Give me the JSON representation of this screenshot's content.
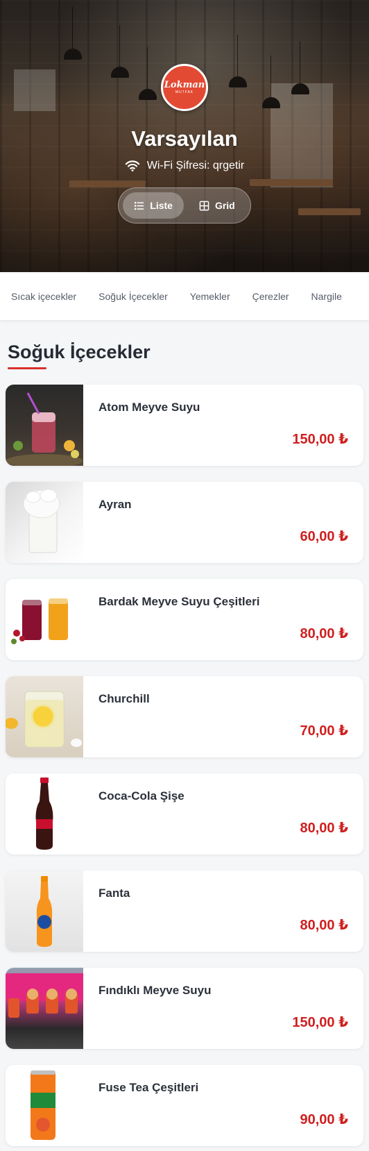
{
  "venue": {
    "logo_text": "Lokman",
    "logo_subtext": "MUTFAK",
    "title": "Varsayılan",
    "wifi_text": "Wi-Fi Şifresi: qrgetir"
  },
  "view_toggle": {
    "list_label": "Liste",
    "grid_label": "Grid",
    "active": "list"
  },
  "categories": [
    "Sıcak içecekler",
    "Soğuk İçecekler",
    "Yemekler",
    "Çerezler",
    "Nargile"
  ],
  "section": {
    "title": "Soğuk İçecekler"
  },
  "products": [
    {
      "name": "Atom Meyve Suyu",
      "price": "150,00 ₺"
    },
    {
      "name": "Ayran",
      "price": "60,00 ₺"
    },
    {
      "name": "Bardak Meyve Suyu Çeşitleri",
      "price": "80,00 ₺"
    },
    {
      "name": "Churchill",
      "price": "70,00 ₺"
    },
    {
      "name": "Coca-Cola Şişe",
      "price": "80,00 ₺"
    },
    {
      "name": "Fanta",
      "price": "80,00 ₺"
    },
    {
      "name": "Fındıklı Meyve Suyu",
      "price": "150,00 ₺"
    },
    {
      "name": "Fuse Tea Çeşitleri",
      "price": "90,00 ₺"
    }
  ],
  "colors": {
    "accent": "#cf1f1f",
    "underline": "#d9302b",
    "logo_bg": "#e34a33"
  },
  "icons": {
    "wifi": "wifi-icon",
    "list": "list-icon",
    "grid": "grid-icon"
  }
}
